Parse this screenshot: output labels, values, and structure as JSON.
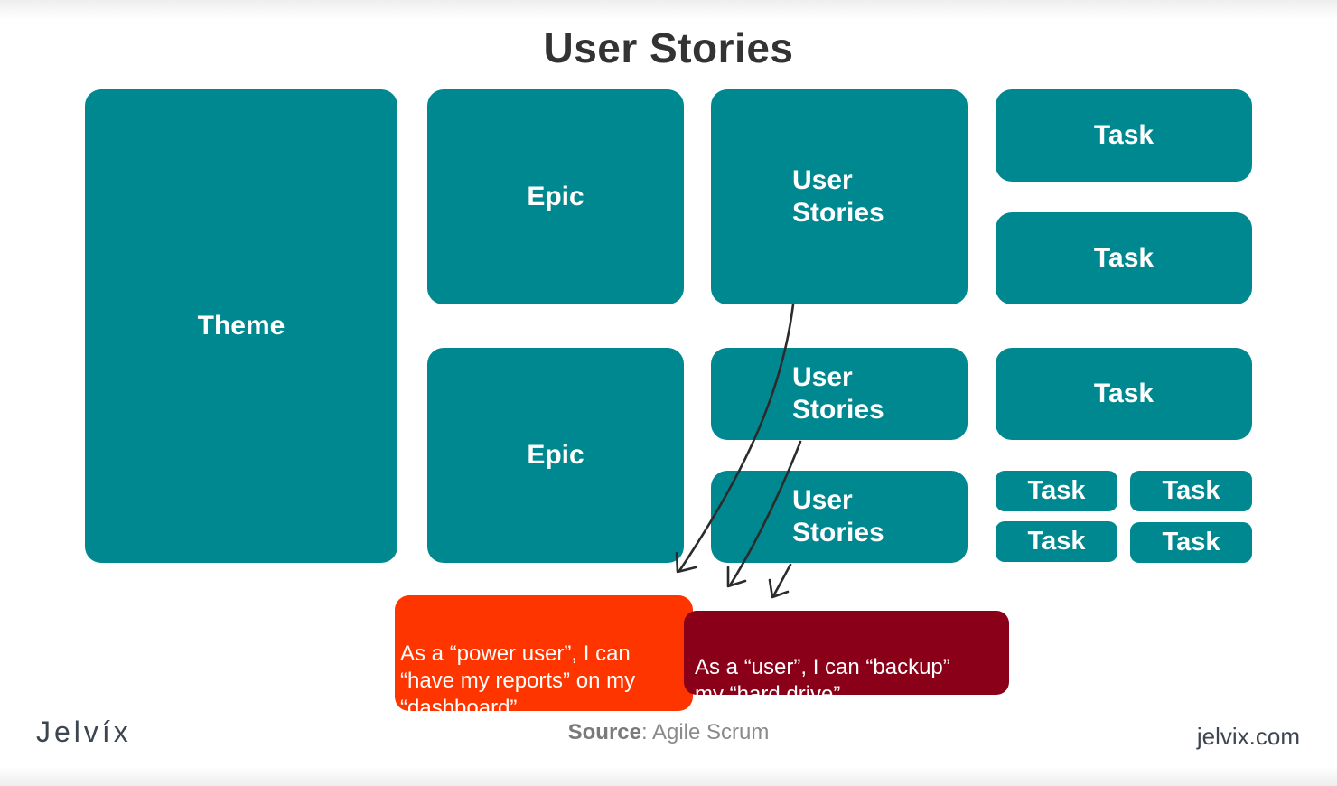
{
  "title": "User Stories",
  "colors": {
    "box": "#008890",
    "power_user_note": "#ff3500",
    "user_note": "#8b0019",
    "title": "#333333",
    "arrow": "#2b2b2b"
  },
  "theme": {
    "label": "Theme"
  },
  "epics": [
    {
      "label": "Epic"
    },
    {
      "label": "Epic"
    }
  ],
  "user_stories": [
    {
      "label": "User\nStories"
    },
    {
      "label": "User\nStories"
    },
    {
      "label": "User\nStories"
    }
  ],
  "tasks": [
    {
      "label": "Task"
    },
    {
      "label": "Task"
    },
    {
      "label": "Task"
    },
    {
      "label": "Task"
    },
    {
      "label": "Task"
    },
    {
      "label": "Task"
    },
    {
      "label": "Task"
    }
  ],
  "notes": [
    {
      "text": "As a “power user”, I can\n“have my reports” on my\n“dashboard”."
    },
    {
      "text": "As a “user”, I can “backup”\nmy “hard drive”."
    }
  ],
  "footer": {
    "logo": "Jelvíx",
    "source_label": "Source",
    "source_value": ": Agile Scrum",
    "site": "jelvix.com"
  }
}
